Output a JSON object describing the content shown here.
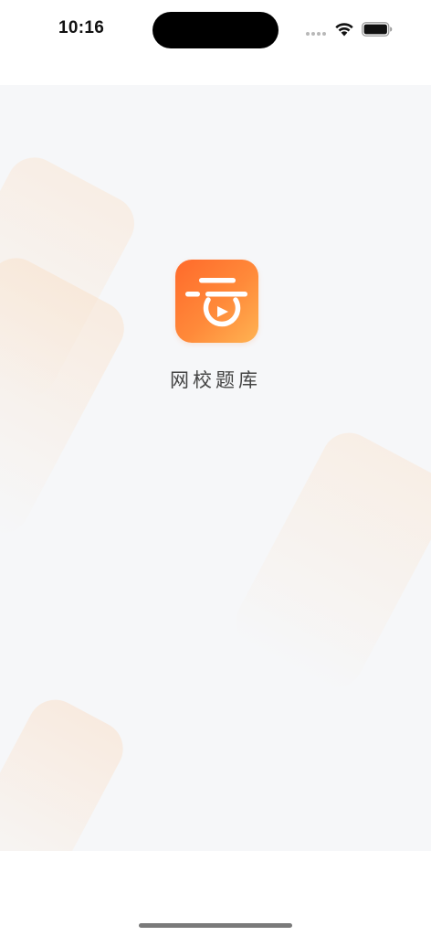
{
  "status_bar": {
    "time": "10:16",
    "icons": [
      "cellular-signal-icon",
      "wifi-icon",
      "battery-icon"
    ]
  },
  "splash": {
    "app_name": "网校题库",
    "logo_icon": "play-logo-icon"
  },
  "colors": {
    "brand_orange_start": "#ff6a2b",
    "brand_orange_end": "#ffb352",
    "background": "#f6f7f9",
    "text": "#444444"
  }
}
